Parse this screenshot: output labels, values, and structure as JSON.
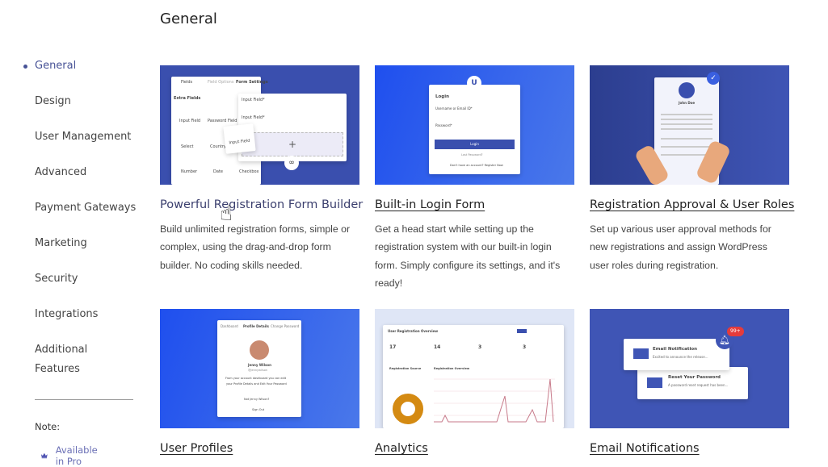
{
  "page": {
    "title": "General"
  },
  "sidebar": {
    "items": [
      {
        "label": "General",
        "active": true
      },
      {
        "label": "Design"
      },
      {
        "label": "User Management"
      },
      {
        "label": "Advanced"
      },
      {
        "label": "Payment Gateways"
      },
      {
        "label": "Marketing"
      },
      {
        "label": "Security"
      },
      {
        "label": "Integrations"
      },
      {
        "label": "Additional"
      },
      {
        "label": "Features"
      }
    ],
    "note_label": "Note:",
    "pro_label": "Available in Pro",
    "pro_icon": "crown-icon"
  },
  "colors": {
    "accent": "#475296",
    "card_blue": "#3f55b5",
    "bright_blue": "#2957e8",
    "badge_red": "#e53b3b"
  },
  "cards": [
    {
      "title": "Powerful Registration Form Builder",
      "desc": "Build unlimited registration forms, simple or complex, using the drag-and-drop form builder. No coding skills needed.",
      "img": {
        "tabs": [
          "Fields",
          "Field Options",
          "Form Settings"
        ],
        "section": "Extra Fields",
        "fields": [
          "Input Field",
          "Password Field",
          "Select",
          "Country",
          "Number",
          "Date",
          "Checkbox"
        ],
        "input1": "Input Field*",
        "input2": "Input Field*",
        "drag": "Input Field",
        "plus": "+"
      }
    },
    {
      "title": "Built-in Login Form",
      "desc": "Get a head start while setting up the registration system with our built-in login form. Simply configure its settings, and it's ready!",
      "img": {
        "heading": "Login",
        "user": "Username or Email ID*",
        "pass": "Password*",
        "button": "Login",
        "lost": "Lost Password?",
        "register": "Don't have an account? Register Now"
      }
    },
    {
      "title": "Registration Approval & User Roles",
      "desc": "Set up various user approval methods for new registrations and assign WordPress user roles during registration.",
      "img": {
        "name": "John Doe"
      }
    },
    {
      "title": "User Profiles",
      "desc": "",
      "img": {
        "tabs": [
          "Dashboard",
          "Profile Details",
          "Change Password"
        ],
        "name": "Jenny Wilson",
        "handle": "@jennywilson",
        "text1": "From your account dashboard you can edit",
        "text2": "your Profile Details and Edit Your Password",
        "not": "Not Jenny Wilson?",
        "signout": "Sign Out"
      }
    },
    {
      "title": "Analytics",
      "desc": "",
      "img": {
        "heading": "User Registration Overview",
        "stats": [
          "17",
          "14",
          "3",
          "3"
        ],
        "left": "Registration Source",
        "right": "Registration Overview"
      }
    },
    {
      "title": "Email Notifications",
      "desc": "",
      "img": {
        "badge": "99+",
        "n1_title": "Email Notification",
        "n1_text": "Excited to announce the release...",
        "n2_title": "Reset Your Password",
        "n2_text": "A password reset request has been..."
      }
    }
  ]
}
